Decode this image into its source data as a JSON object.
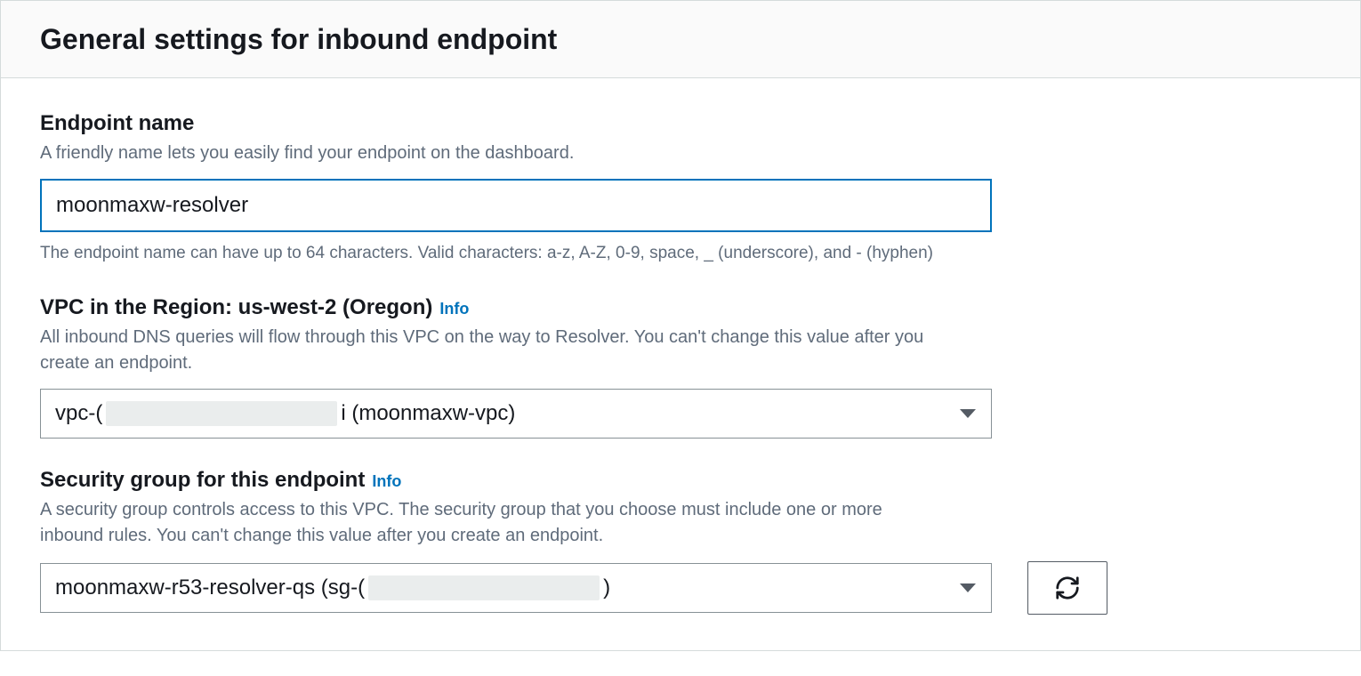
{
  "panel": {
    "title": "General settings for inbound endpoint"
  },
  "endpoint_name": {
    "label": "Endpoint name",
    "hint": "A friendly name lets you easily find your endpoint on the dashboard.",
    "value": "moonmaxw-resolver",
    "constraint": "The endpoint name can have up to 64 characters. Valid characters: a-z, A-Z, 0-9, space, _ (underscore), and - (hyphen)"
  },
  "vpc": {
    "label": "VPC in the Region: us-west-2 (Oregon)",
    "info_label": "Info",
    "hint": "All inbound DNS queries will flow through this VPC on the way to Resolver. You can't change this value after you create an endpoint.",
    "selected_prefix": "vpc-(",
    "selected_suffix": "i (moonmaxw-vpc)"
  },
  "security_group": {
    "label": "Security group for this endpoint",
    "info_label": "Info",
    "hint": "A security group controls access to this VPC. The security group that you choose must include one or more inbound rules. You can't change this value after you create an endpoint.",
    "selected_prefix": "moonmaxw-r53-resolver-qs (sg-(",
    "selected_suffix": ")"
  }
}
